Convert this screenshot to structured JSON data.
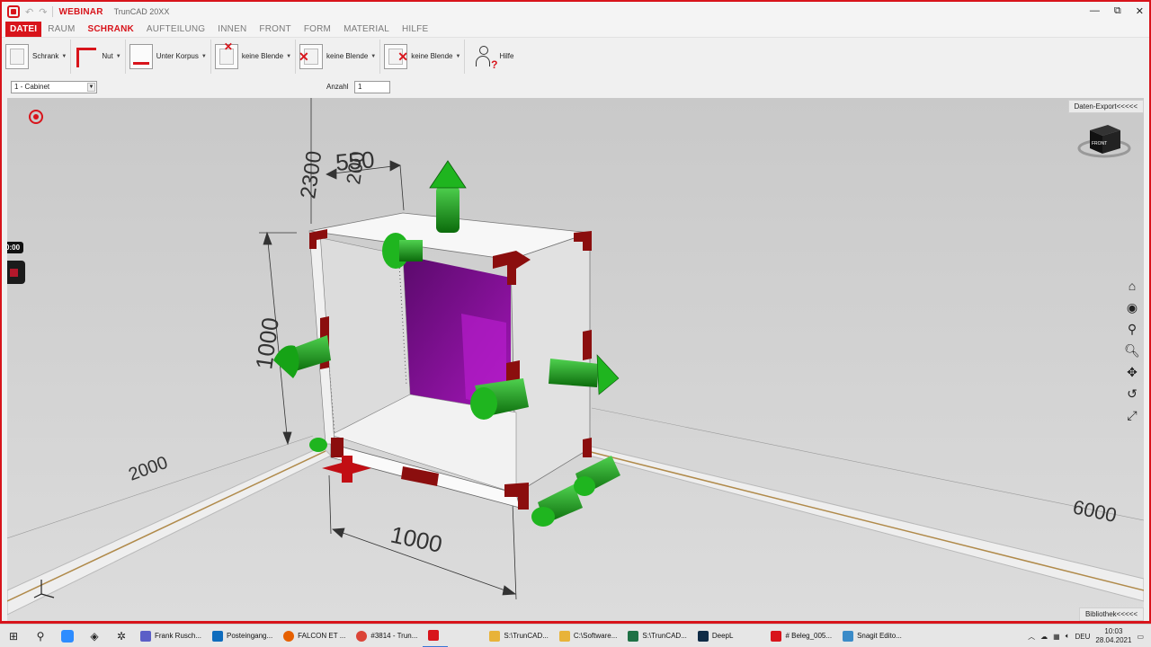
{
  "window": {
    "project": "WEBINAR",
    "app_name": "TrunCAD 20XX",
    "minimize": "—",
    "restore": "⧉",
    "close": "✕"
  },
  "menu": {
    "file": "DATEI",
    "items": [
      "RAUM",
      "SCHRANK",
      "AUFTEILUNG",
      "INNEN",
      "FRONT",
      "FORM",
      "MATERIAL",
      "HILFE"
    ],
    "active_index": 1
  },
  "ribbon": {
    "schrank": "Schrank",
    "nut": "Nut",
    "unter_korpus": "Unter Korpus",
    "blende1": "keine Blende",
    "blende2": "keine Blende",
    "blende3": "keine Blende",
    "hilfe": "Hilfe"
  },
  "selection": {
    "cabinet_value": "1 - Cabinet",
    "anzahl_label": "Anzahl",
    "anzahl_value": "1"
  },
  "viewport": {
    "export_button": "Daten-Export<<<<<",
    "library_button": "Bibliothek<<<<<",
    "view_cube_label": "FRONT",
    "dimensions": {
      "height_top": "2300",
      "depth_top": "550",
      "depth_top2": "200",
      "height": "1000",
      "width": "1000",
      "room_left": "2000",
      "room_right": "6000"
    },
    "colors": {
      "accent": "#d8141b",
      "back_panel": "#8b0f9e",
      "handles": "#16a316",
      "carcass_edge": "#8b0e0e"
    }
  },
  "recorder": {
    "timer": "0:00"
  },
  "taskbar": {
    "apps": [
      {
        "label": "Frank Rusch...",
        "color": "#5b5fc7"
      },
      {
        "label": "Posteingang...",
        "color": "#0f6cbd"
      },
      {
        "label": "FALCON ET ...",
        "color": "#e66000"
      },
      {
        "label": "#3814 - Trun...",
        "color": "#db4437"
      },
      {
        "label": "",
        "color": "#d8141b"
      },
      {
        "label": "S:\\TrunCAD...",
        "color": "#e8b339"
      },
      {
        "label": "C:\\Software...",
        "color": "#e8b339"
      },
      {
        "label": "S:\\TrunCAD...",
        "color": "#1e7145"
      },
      {
        "label": "DeepL",
        "color": "#0f2b46"
      },
      {
        "label": "# Beleg_005...",
        "color": "#d8141b"
      },
      {
        "label": "Snagit Edito...",
        "color": "#3b8bc8"
      }
    ],
    "language": "DEU",
    "time": "10:03",
    "date": "28.04.2021"
  }
}
